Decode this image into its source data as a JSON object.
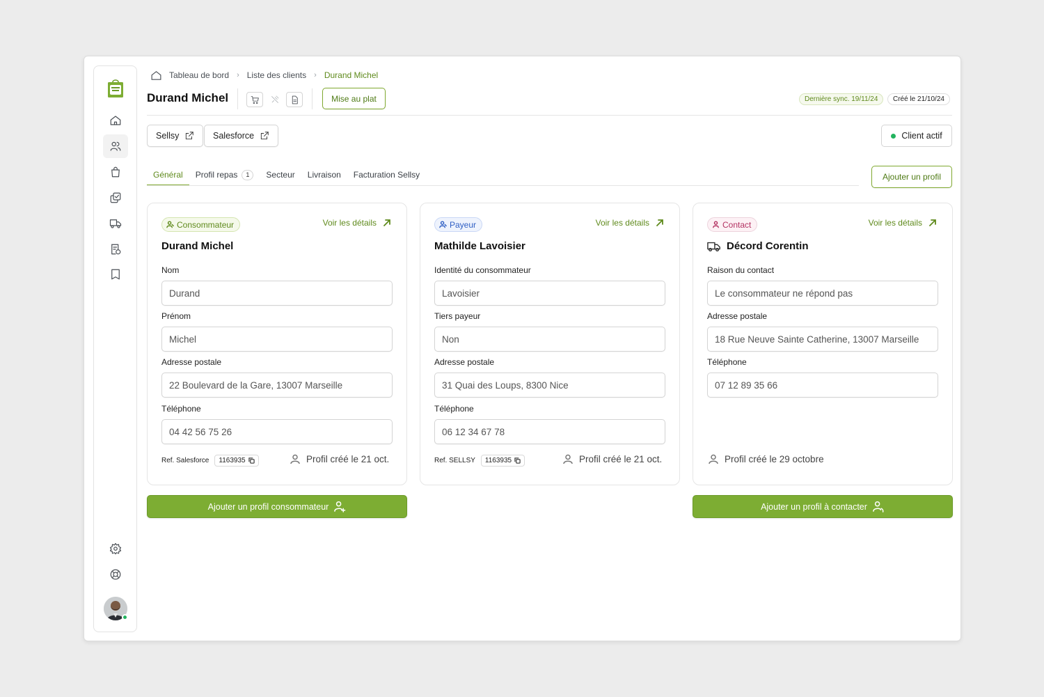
{
  "breadcrumb": {
    "home": "Tableau de bord",
    "list": "Liste des clients",
    "current": "Durand Michel"
  },
  "header": {
    "title": "Durand Michel",
    "mise_au_plat": "Mise au plat",
    "last_sync": "Dernière sync. 19/11/24",
    "created": "Créé le 21/10/24"
  },
  "external": {
    "sellsy": "Sellsy",
    "salesforce": "Salesforce",
    "status": "Client actif"
  },
  "tabs": [
    {
      "label": "Général"
    },
    {
      "label": "Profil repas",
      "count": "1"
    },
    {
      "label": "Secteur"
    },
    {
      "label": "Livraison"
    },
    {
      "label": "Facturation Sellsy"
    }
  ],
  "add_profile": "Ajouter un profil",
  "details_label": "Voir les détails",
  "cards": [
    {
      "role": "Consommateur",
      "name": "Durand Michel",
      "fields": [
        {
          "label": "Nom",
          "value": "Durand"
        },
        {
          "label": "Prénom",
          "value": "Michel"
        },
        {
          "label": "Adresse postale",
          "value": "22 Boulevard de la Gare, 13007 Marseille"
        },
        {
          "label": "Téléphone",
          "value": "04 42 56 75 26"
        }
      ],
      "ref_label": "Ref. Salesforce",
      "ref_value": "1163935",
      "created": "Profil créé le 21 oct."
    },
    {
      "role": "Payeur",
      "name": "Mathilde Lavoisier",
      "fields": [
        {
          "label": "Identité du consommateur",
          "value": "Lavoisier"
        },
        {
          "label": "Tiers payeur",
          "value": "Non"
        },
        {
          "label": "Adresse postale",
          "value": "31 Quai des Loups, 8300 Nice"
        },
        {
          "label": "Téléphone",
          "value": "06 12 34 67 78"
        }
      ],
      "ref_label": "Ref. SELLSY",
      "ref_value": "1163935",
      "created": "Profil créé le 21 oct."
    },
    {
      "role": "Contact",
      "name": "Décord Corentin",
      "fields": [
        {
          "label": "Raison du contact",
          "value": "Le consommateur ne répond pas"
        },
        {
          "label": "Adresse postale",
          "value": "18 Rue Neuve Sainte Catherine, 13007 Marseille"
        },
        {
          "label": "Téléphone",
          "value": "07 12 89 35 66"
        }
      ],
      "created": "Profil créé le 29 octobre"
    }
  ],
  "actions": {
    "add_consumer": "Ajouter un profil consommateur",
    "add_contact": "Ajouter un profil à contacter"
  },
  "colors": {
    "accent": "#7dad33",
    "accent_text": "#5f8a1c",
    "payer": "#2f5fc4",
    "contact": "#b33262",
    "status_ok": "#22b35e"
  }
}
